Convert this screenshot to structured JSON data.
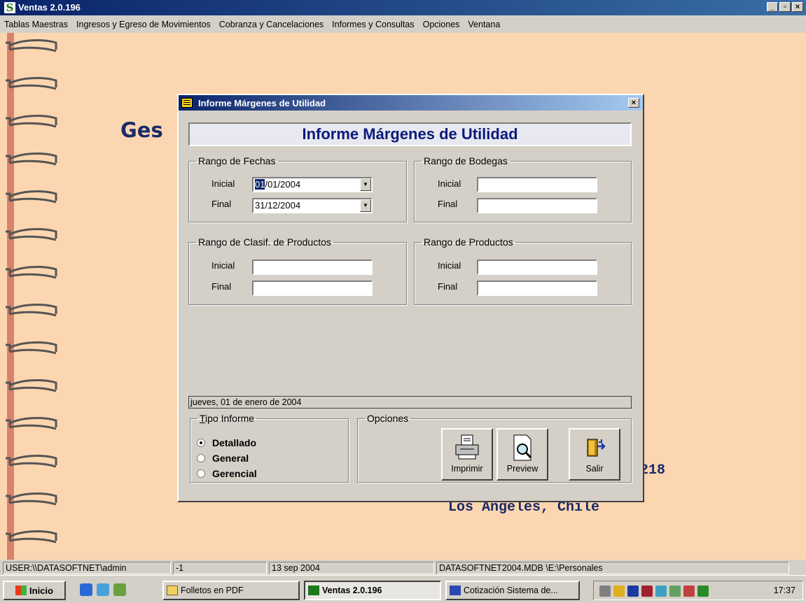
{
  "app": {
    "title": "Ventas 2.0.196",
    "icon_letter": "S",
    "menu": [
      "Tablas Maestras",
      "Ingresos y Egreso de Movimientos",
      "Cobranza y Cancelaciones",
      "Informes y Consultas",
      "Opciones",
      "Ventana"
    ]
  },
  "background": {
    "title_fragment": "Ges",
    "phone_fragment": "218",
    "city": "Los Angeles, Chile"
  },
  "dialog": {
    "title": "Informe Márgenes de Utilidad",
    "header": "Informe Márgenes de Utilidad",
    "fechas": {
      "legend": "Rango de Fechas",
      "inicial_label": "Inicial",
      "final_label": "Final",
      "inicial_day": "01",
      "inicial_rest": "/01/2004",
      "final_value": "31/12/2004"
    },
    "bodegas": {
      "legend": "Rango de Bodegas",
      "inicial_label": "Inicial",
      "final_label": "Final"
    },
    "clasif": {
      "legend": "Rango de Clasif. de Productos",
      "inicial_label": "Inicial",
      "final_label": "Final"
    },
    "productos": {
      "legend": "Rango de Productos",
      "inicial_label": "Inicial",
      "final_label": "Final"
    },
    "status_text": "jueves, 01 de enero de 2004",
    "tipo": {
      "legend": "Tipo Informe",
      "options": [
        "Detallado",
        "General",
        "Gerencial"
      ],
      "selected": "Detallado"
    },
    "opciones": {
      "legend": "Opciones",
      "imprimir": "Imprimir",
      "preview": "Preview",
      "salir": "Salir"
    }
  },
  "statusbar": {
    "user": "USER:\\\\DATASOFTNET\\admin",
    "code": "-1",
    "date": "13 sep 2004",
    "db": "DATASOFTNET2004.MDB \\E:\\Personales"
  },
  "taskbar": {
    "start": "Inicio",
    "tasks": [
      "Folletos en PDF",
      "Ventas 2.0.196",
      "Cotización Sistema de..."
    ],
    "clock": "17:37"
  },
  "colors": {
    "mdi_background": "#fcd6b0",
    "title_blue": "#0a246a",
    "header_text": "#0a1a7a"
  }
}
